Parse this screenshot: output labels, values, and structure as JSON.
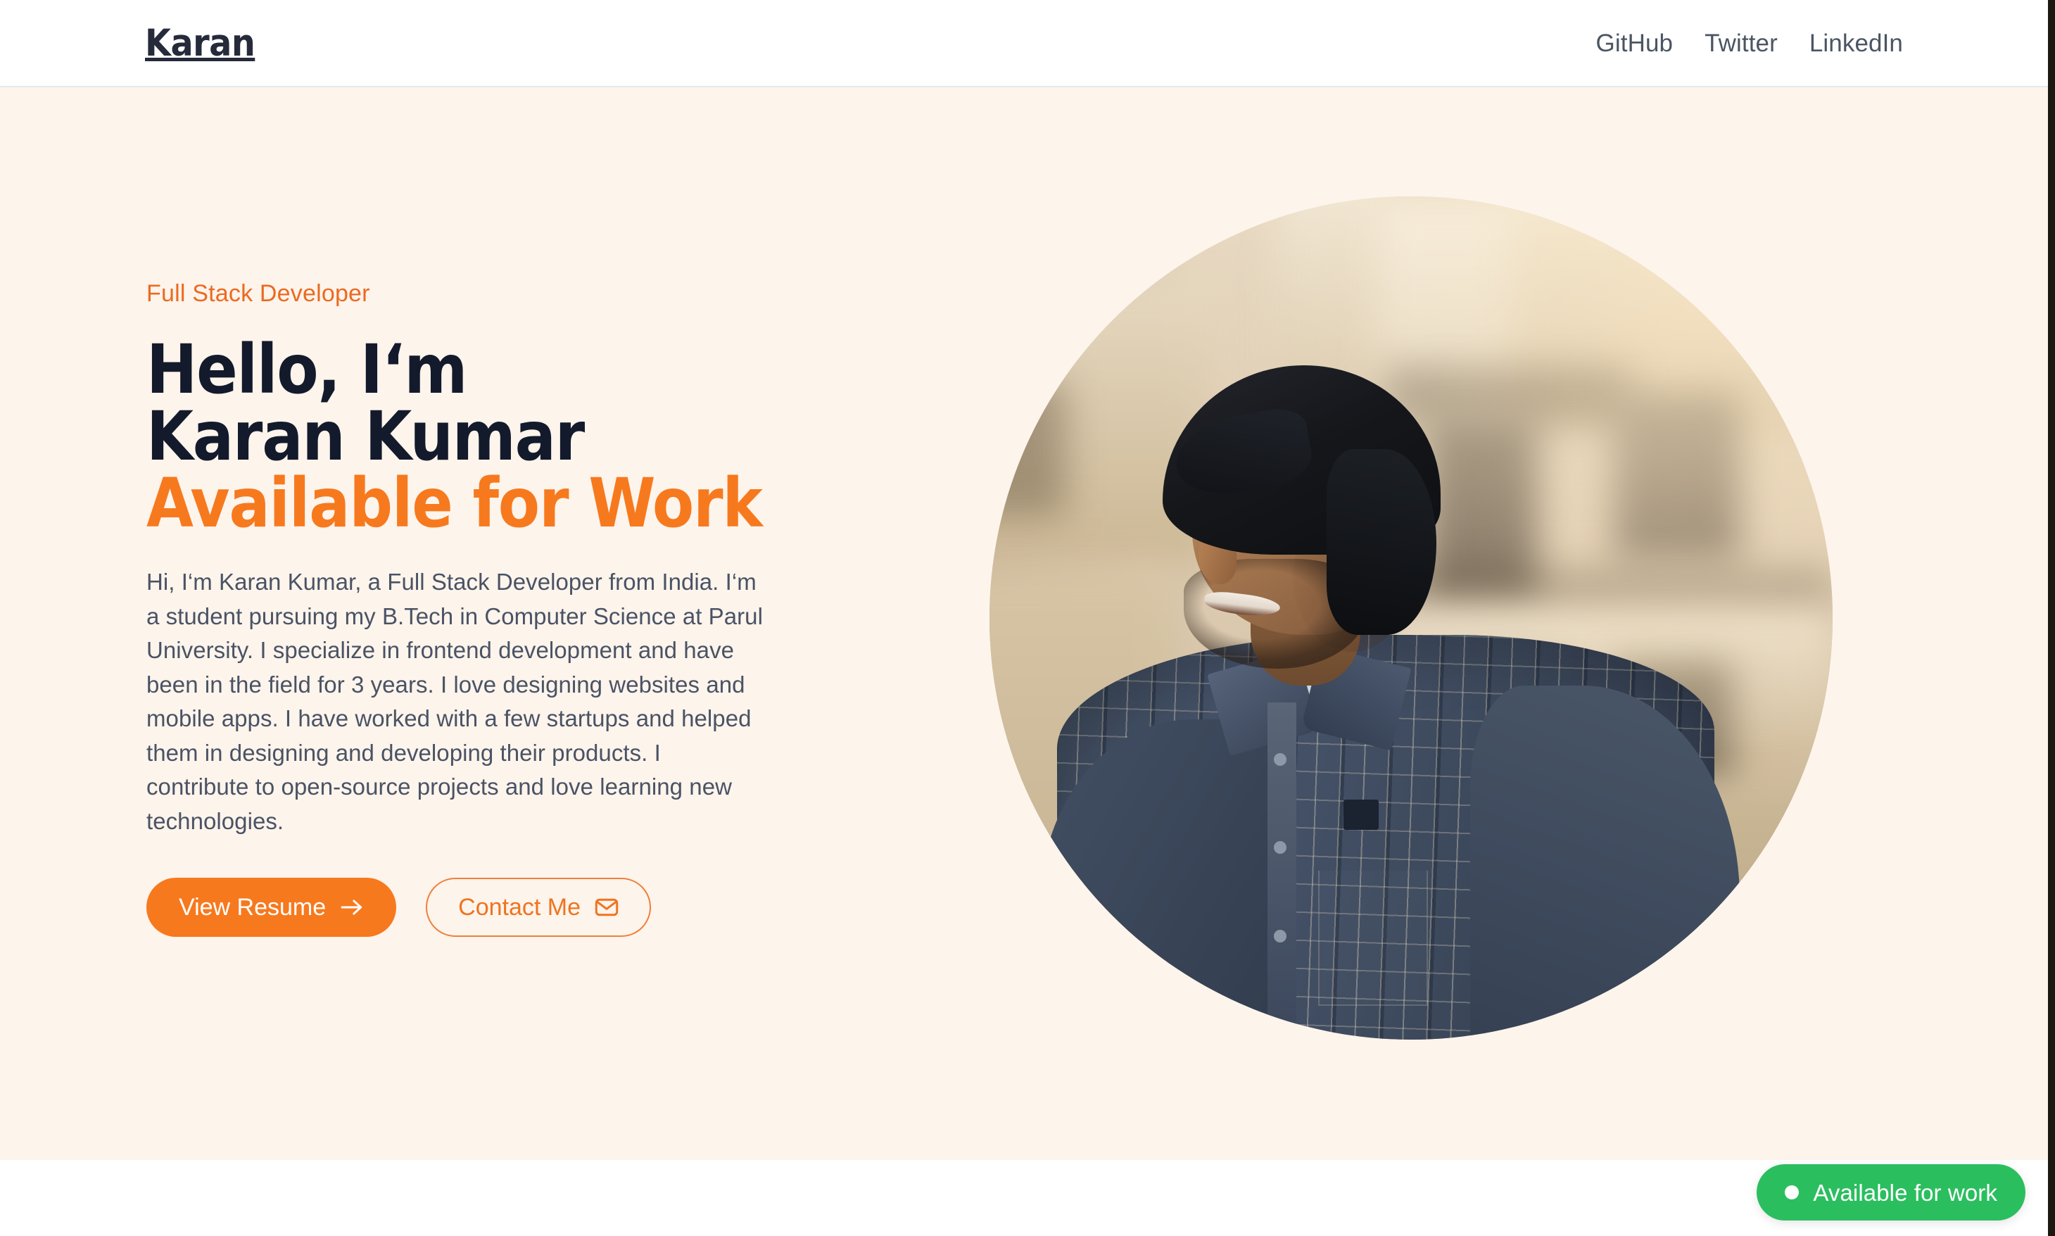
{
  "header": {
    "logo": "Karan",
    "nav": [
      {
        "label": "GitHub"
      },
      {
        "label": "Twitter"
      },
      {
        "label": "LinkedIn"
      }
    ]
  },
  "hero": {
    "eyebrow": "Full Stack Developer",
    "title_line1": "Hello, I‘m",
    "title_line2": "Karan Kumar",
    "title_line3": "Available for Work",
    "description": "Hi, I‘m Karan Kumar, a Full Stack Developer from India. I‘m a student pursuing my B.Tech in Computer Science at Parul University. I specialize in frontend development and have been in the field for 3 years. I love designing websites and mobile apps. I have worked with a few startups and helped them in designing and developing their products. I contribute to open-source projects and love learning new technologies.",
    "primary_button": "View Resume",
    "secondary_button": "Contact Me",
    "portrait_alt": "Portrait of Karan Kumar"
  },
  "badge": {
    "label": "Available for work"
  },
  "colors": {
    "accent_orange": "#f7791e",
    "eyebrow_orange": "#ec6a20",
    "heading_dark": "#131a2b",
    "logo_dark": "#262b3b",
    "body_text": "#4a5364",
    "nav_text": "#4b5563",
    "hero_background": "#fdf4ec",
    "header_background": "#ffffff",
    "header_border": "#e4e8ec",
    "badge_green": "#2bbe5f",
    "badge_text": "#ffffff"
  }
}
